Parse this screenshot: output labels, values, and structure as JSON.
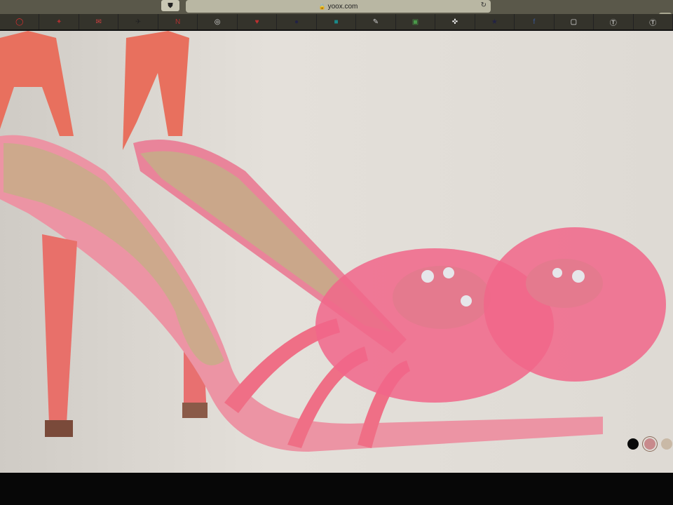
{
  "browser": {
    "url": "yoox.com",
    "lock_icon": "lock-icon",
    "tabs": [
      {
        "icon": "opera-icon",
        "color": "#e03030"
      },
      {
        "icon": "bird-icon",
        "color": "#b03030"
      },
      {
        "icon": "gmail-icon",
        "color": "#d04040"
      },
      {
        "icon": "plane-icon",
        "color": "#222222"
      },
      {
        "icon": "nk-icon",
        "color": "#b03030"
      },
      {
        "icon": "circle-icon",
        "color": "#dddddd"
      },
      {
        "icon": "heart-icon",
        "color": "#c03030"
      },
      {
        "icon": "pin-icon",
        "color": "#222244"
      },
      {
        "icon": "square-icon",
        "color": "#1a8a8a"
      },
      {
        "icon": "feather-icon",
        "color": "#cccccc"
      },
      {
        "icon": "photo-icon",
        "color": "#4a9a4a"
      },
      {
        "icon": "compass-icon",
        "color": "#eeeeee"
      },
      {
        "icon": "star-icon",
        "color": "#222244"
      },
      {
        "icon": "facebook-icon",
        "color": "#3b5998"
      },
      {
        "icon": "frame-icon",
        "color": "#eeeeee"
      },
      {
        "icon": "t-icon",
        "color": "#eeeeee"
      },
      {
        "icon": "t-icon",
        "color": "#eeeeee"
      }
    ]
  },
  "product": {
    "image": "pink-sandals",
    "color_swatches": [
      {
        "name": "black",
        "color": "#0a0a0a",
        "selected": false
      },
      {
        "name": "pink",
        "color": "#c88a8c",
        "selected": true
      },
      {
        "name": "nude",
        "color": "#c9b9a6",
        "selected": false
      }
    ]
  }
}
